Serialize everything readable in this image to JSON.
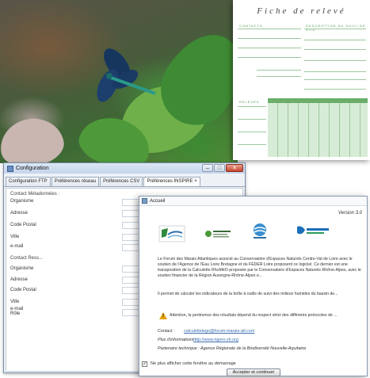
{
  "form": {
    "title": "Fiche de relevé",
    "header_left": "CONTACTS",
    "header_right": "DESCRIPTION DU SUIVI DE SITE",
    "grid_header": "RELEVÉS"
  },
  "config_window": {
    "title": "Configuration",
    "controls": {
      "minimize": "–",
      "maximize": "□",
      "close": "✕"
    },
    "tabs": [
      {
        "label": "Configuration FTP"
      },
      {
        "label": "Préférences réseau"
      },
      {
        "label": "Préférences CSV"
      },
      {
        "label": "Préférences INSPIRE ×"
      }
    ],
    "rows": [
      {
        "label": "Contact Métadonnées :"
      },
      {
        "label": "Organisme"
      },
      {
        "label": "Adresse"
      },
      {
        "label": "Code Postal"
      },
      {
        "label": "Ville"
      },
      {
        "label": "e-mail"
      },
      {
        "label": "Contact Ress..."
      },
      {
        "label": "Organisme"
      },
      {
        "label": "Adresse"
      },
      {
        "label": "Code Postal"
      },
      {
        "label": "Ville"
      },
      {
        "label": "e-mail"
      },
      {
        "label": "Rôle"
      }
    ]
  },
  "accueil": {
    "title": "Accueil",
    "version": "Version 3.0",
    "paragraph1": "Le Forum des Marais Atlantiques associé au Conservatoire d'Espaces Naturels Centre-Val de Loire avec le soutien de l'Agence de l'Eau Loire Bretagne et du FEDER Loire proposent ce logiciel. Ce dernier est une transposition de la Calculette RhoMéO proposée par le Conservatoire d'Espaces Naturels Rhône-Alpes, avec le soutien financier de la Région Auvergne-Rhône-Alpes e...",
    "paragraph2": "Il permet de calculer les indicateurs de la boîte à outils de suivi des milieux humides du bassin de...",
    "warning": "Attention, la pertinence des résultats dépend du respect strict des différents protocoles de ...",
    "contact_label": "Contact :",
    "contact_value": "calculettelego@forum-marais-atl.com",
    "info_label": "Plus d'informations :",
    "info_value": "http://www.rigero-zh.org",
    "partner": "Partenaire technique : Agence Régionale de la Biodiversité Nouvelle-Aquitaine",
    "checkbox_label": "Ne plus afficher cette fenêtre au démarrage",
    "checkbox_mark": "✓",
    "button_label": "Accepter et continuer",
    "warning_mark": "!"
  }
}
